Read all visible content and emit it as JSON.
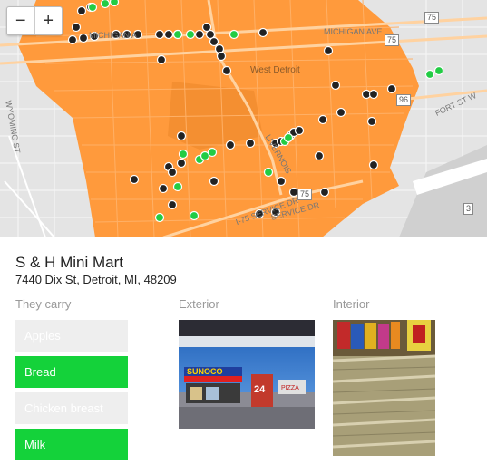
{
  "map": {
    "zoom_in": "+",
    "zoom_out": "−",
    "labels": {
      "west_detroit": "West Detroit",
      "michigan_ave_1": "MICHIGAN A",
      "michigan_ave_2": "MICHIGAN AVE",
      "wyoming_st": "WYOMING ST",
      "fort_st": "FORT ST W",
      "livernois": "LIVERNOIS",
      "service_dr": "I-75 SERVICE DR",
      "service_dr_2": "SERVICE DR",
      "shield_75_top": "75",
      "shield_75_mid": "75",
      "shield_96": "96",
      "shield_75_low": "75",
      "shield_3": "3"
    },
    "colors": {
      "region": "#ff9a3c",
      "carries_item": "#22cc44",
      "store": "#222222"
    }
  },
  "store": {
    "name": "S & H Mini Mart",
    "address": "7440 Dix St, Detroit, MI, 48209"
  },
  "sections": {
    "carry_heading": "They carry",
    "exterior_heading": "Exterior",
    "interior_heading": "Interior"
  },
  "items": [
    {
      "label": "Apples",
      "carried": false
    },
    {
      "label": "Bread",
      "carried": true
    },
    {
      "label": "Chicken breast",
      "carried": false
    },
    {
      "label": "Milk",
      "carried": true
    }
  ],
  "photos": {
    "exterior_sign_text": "SUNOCO",
    "exterior_sign_number": "24",
    "exterior_small_sign": "PIZZA"
  }
}
